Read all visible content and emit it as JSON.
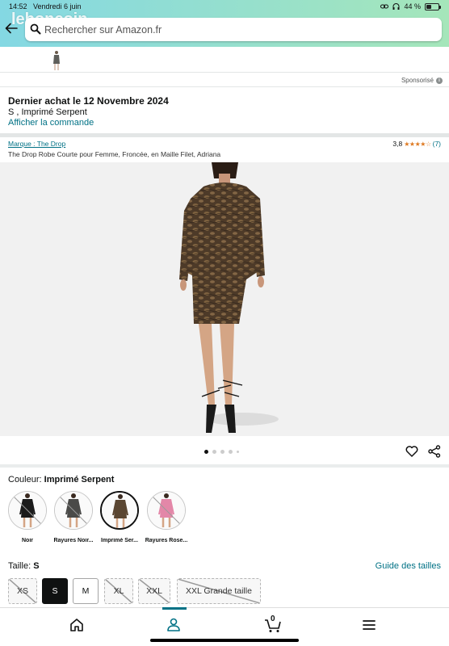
{
  "status_bar": {
    "time": "14:52",
    "date": "Vendredi 6 juin",
    "battery": "44 %",
    "battery_level": 0.44
  },
  "watermark": "leboncoin",
  "search": {
    "placeholder": "Rechercher sur Amazon.fr"
  },
  "sponsored": {
    "label": "Sponsorisé"
  },
  "last_purchase": {
    "title": "Dernier achat le 12 Novembre 2024",
    "variant": "S , Imprimé Serpent",
    "link": "Afficher la commande"
  },
  "product": {
    "brand": "Marque : The Drop",
    "rating_value": "3,8",
    "rating_stars": 3.8,
    "review_count": "(7)",
    "title": "The Drop Robe Courte pour Femme, Froncée, en Maille Filet, Adriana",
    "image_count": 5,
    "active_image": 1
  },
  "color": {
    "label": "Couleur: ",
    "selected": "Imprimé Serpent",
    "options": [
      {
        "name": "Noir",
        "unavailable": true,
        "dress_color": "#1b1b1b"
      },
      {
        "name": "Rayures Noir...",
        "unavailable": true,
        "dress_color": "#4a4a48"
      },
      {
        "name": "Imprimé Ser...",
        "unavailable": false,
        "dress_color": "#5a4632"
      },
      {
        "name": "Rayures Rose...",
        "unavailable": true,
        "dress_color": "#e387a8"
      }
    ]
  },
  "size": {
    "label": "Taille: ",
    "selected": "S",
    "guide": "Guide des tailles",
    "options": [
      {
        "label": "XS",
        "state": "unavailable"
      },
      {
        "label": "S",
        "state": "selected"
      },
      {
        "label": "M",
        "state": "available"
      },
      {
        "label": "XL",
        "state": "unavailable"
      },
      {
        "label": "XXL",
        "state": "unavailable"
      },
      {
        "label": "XXL Grande taille",
        "state": "unavailable"
      }
    ]
  },
  "cart": {
    "count": "0"
  },
  "icons": {
    "back": "back-arrow-icon",
    "search": "search-icon",
    "heart": "heart-icon",
    "share": "share-icon",
    "home": "home-icon",
    "account": "account-icon",
    "cart": "cart-icon",
    "menu": "menu-icon"
  },
  "colors": {
    "link": "#007185",
    "star": "#de7921",
    "header_start": "#84d8e3",
    "header_end": "#a5e6ba"
  }
}
